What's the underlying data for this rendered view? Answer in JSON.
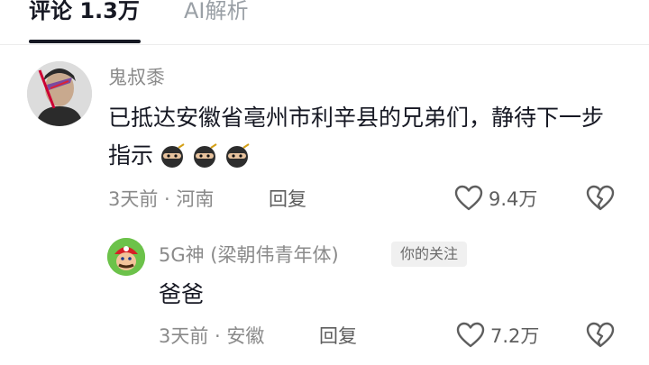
{
  "tabs": [
    {
      "label": "评论 1.3万",
      "active": true
    },
    {
      "label": "AI解析",
      "active": false
    }
  ],
  "comments": [
    {
      "username": "鬼叔黍",
      "text": "已抵达安徽省亳州市利辛县的兄弟们，静待下一步指示",
      "emojis": [
        "ninja",
        "ninja",
        "ninja"
      ],
      "meta": "3天前 · 河南",
      "reply_label": "回复",
      "likes": "9.4万"
    },
    {
      "username": "5G神 (梁朝伟青年体)",
      "badge": "你的关注",
      "text": "爸爸",
      "meta": "3天前 · 安徽",
      "reply_label": "回复",
      "likes": "7.2万"
    }
  ],
  "colors": {
    "primary_text": "#161823",
    "secondary_text": "#8a8a8a",
    "divider": "#ececec"
  },
  "icons": [
    "heart-outline-icon",
    "broken-heart-icon",
    "ninja-emoji"
  ]
}
